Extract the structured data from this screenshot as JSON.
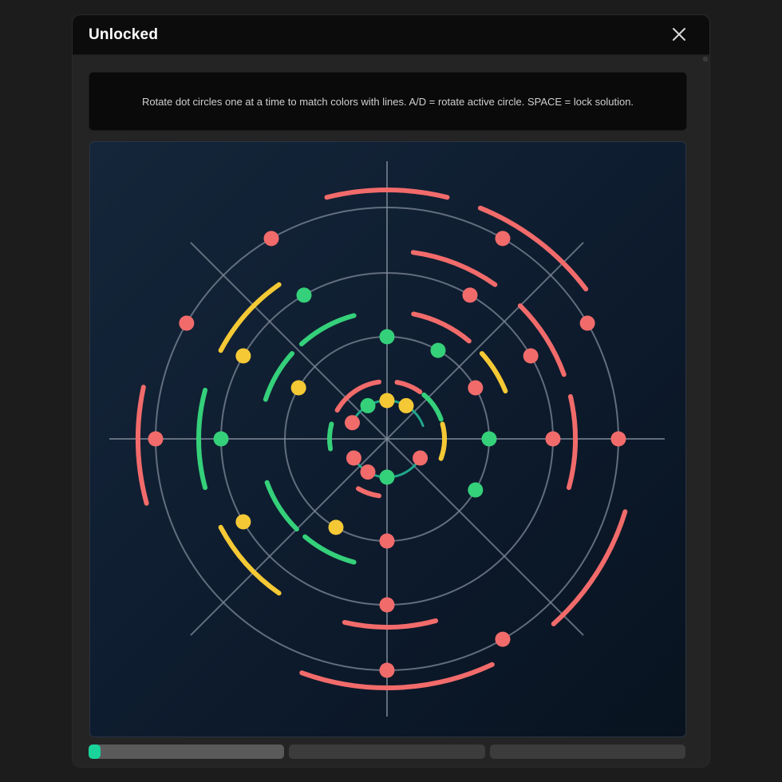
{
  "window": {
    "title": "Unlocked",
    "close_icon": "close-icon"
  },
  "instructions": {
    "text": "Rotate dot circles one at a time to match colors with lines. A/D = rotate active circle. SPACE = lock solution."
  },
  "puzzle": {
    "colors": {
      "red": "#f26b6b",
      "green": "#35d07a",
      "yellow": "#f5c935",
      "teal": "#1fa88a",
      "guide": "#7f8a99"
    },
    "radial_line_angles_deg": [
      0,
      45,
      90,
      135,
      180,
      225,
      270,
      315
    ],
    "rings": [
      {
        "id": "ring-1",
        "guide_circle": false,
        "active": true,
        "line_arcs": [
          {
            "color": "teal",
            "from": 20,
            "to": 160
          },
          {
            "color": "teal",
            "from": 200,
            "to": 340
          }
        ],
        "dots": [
          {
            "color": "yellow",
            "angle": 90
          },
          {
            "color": "yellow",
            "angle": 60
          },
          {
            "color": "green",
            "angle": 120
          },
          {
            "color": "red",
            "angle": 155
          },
          {
            "color": "red",
            "angle": 210
          },
          {
            "color": "red",
            "angle": 240
          },
          {
            "color": "green",
            "angle": 270
          },
          {
            "color": "red",
            "angle": 330
          }
        ]
      },
      {
        "id": "ring-2",
        "guide_circle": false,
        "active": false,
        "line_arcs": [
          {
            "color": "red",
            "from": 98,
            "to": 150
          },
          {
            "color": "red",
            "from": 55,
            "to": 80
          },
          {
            "color": "green",
            "from": 20,
            "to": 50
          },
          {
            "color": "yellow",
            "from": -20,
            "to": 15
          },
          {
            "color": "green",
            "from": 165,
            "to": 190
          },
          {
            "color": "red",
            "from": 240,
            "to": 262
          }
        ],
        "dots": []
      },
      {
        "id": "ring-3",
        "guide_circle": true,
        "active": false,
        "line_arcs": [],
        "dots": [
          {
            "color": "green",
            "angle": 90
          },
          {
            "color": "green",
            "angle": 60
          },
          {
            "color": "red",
            "angle": 30
          },
          {
            "color": "green",
            "angle": 0
          },
          {
            "color": "green",
            "angle": -30
          },
          {
            "color": "red",
            "angle": -90
          },
          {
            "color": "yellow",
            "angle": 240
          },
          {
            "color": "yellow",
            "angle": 150
          }
        ]
      },
      {
        "id": "ring-4",
        "guide_circle": false,
        "active": false,
        "line_arcs": [
          {
            "color": "red",
            "from": 50,
            "to": 78
          },
          {
            "color": "yellow",
            "from": 22,
            "to": 42
          },
          {
            "color": "green",
            "from": 105,
            "to": 132
          },
          {
            "color": "green",
            "from": 138,
            "to": 162
          },
          {
            "color": "green",
            "from": 200,
            "to": 225
          },
          {
            "color": "green",
            "from": 230,
            "to": 255
          }
        ],
        "dots": []
      },
      {
        "id": "ring-5",
        "guide_circle": true,
        "active": false,
        "line_arcs": [],
        "dots": [
          {
            "color": "green",
            "angle": 120
          },
          {
            "color": "red",
            "angle": 60
          },
          {
            "color": "red",
            "angle": 30
          },
          {
            "color": "red",
            "angle": 0
          },
          {
            "color": "green",
            "angle": 180
          },
          {
            "color": "yellow",
            "angle": 150
          },
          {
            "color": "yellow",
            "angle": 210
          },
          {
            "color": "red",
            "angle": 270
          }
        ]
      },
      {
        "id": "ring-6",
        "guide_circle": false,
        "active": false,
        "line_arcs": [
          {
            "color": "red",
            "from": 55,
            "to": 82
          },
          {
            "color": "red",
            "from": 20,
            "to": 45
          },
          {
            "color": "red",
            "from": -15,
            "to": 13
          },
          {
            "color": "yellow",
            "from": 125,
            "to": 152
          },
          {
            "color": "green",
            "from": 165,
            "to": 195
          },
          {
            "color": "yellow",
            "from": 208,
            "to": 235
          },
          {
            "color": "red",
            "from": 257,
            "to": 285
          }
        ],
        "dots": []
      },
      {
        "id": "ring-7",
        "guide_circle": true,
        "active": false,
        "line_arcs": [],
        "dots": [
          {
            "color": "red",
            "angle": 120
          },
          {
            "color": "red",
            "angle": 60
          },
          {
            "color": "red",
            "angle": 30
          },
          {
            "color": "red",
            "angle": 0
          },
          {
            "color": "red",
            "angle": -60
          },
          {
            "color": "red",
            "angle": -90
          },
          {
            "color": "red",
            "angle": 180
          },
          {
            "color": "red",
            "angle": 150
          }
        ]
      },
      {
        "id": "ring-8",
        "guide_circle": false,
        "active": false,
        "line_arcs": [
          {
            "color": "red",
            "from": 76,
            "to": 104
          },
          {
            "color": "red",
            "from": 37,
            "to": 68
          },
          {
            "color": "red",
            "from": -48,
            "to": -17
          },
          {
            "color": "red",
            "from": -110,
            "to": -65
          },
          {
            "color": "red",
            "from": 168,
            "to": 195
          }
        ],
        "dots": []
      }
    ]
  },
  "progress": {
    "segments": 3,
    "active_segment": 0,
    "fill_fraction": 0.06,
    "fill_color": "#19d39a"
  }
}
